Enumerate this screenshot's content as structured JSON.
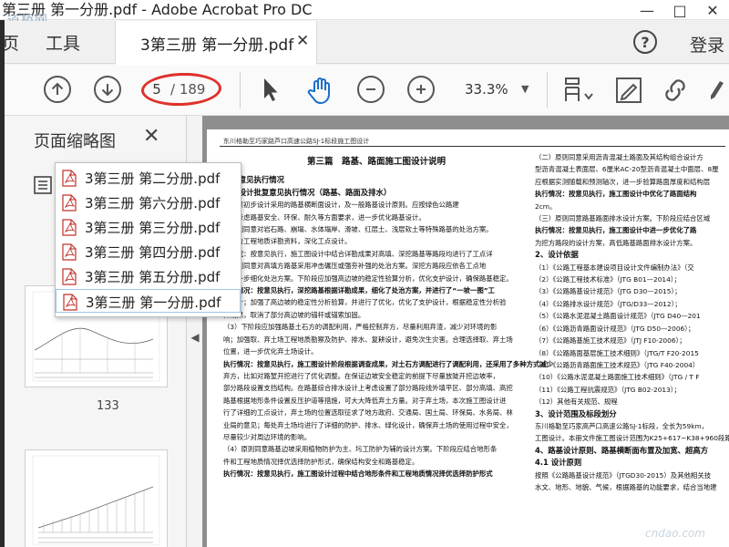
{
  "window": {
    "title": "第三册 第一分册.pdf - Adobe Acrobat Pro DC",
    "watermark": "道桥网",
    "minimize": "—",
    "maximize": "□",
    "close": "✕"
  },
  "menu": {
    "home_partial": "页",
    "tools": "工具",
    "login": "登录",
    "help_glyph": "?"
  },
  "tab": {
    "label": "3第三册 第一分册.pdf",
    "close": "✕"
  },
  "toolbar": {
    "page_current": "5",
    "page_total": "/ 189",
    "zoom": "33.3%",
    "zoom_caret": "▼"
  },
  "sidepane": {
    "title": "页面缩略图",
    "close": "✕",
    "thumb_page_label": "133",
    "collapse_glyph": "◀"
  },
  "dropdown": {
    "items": [
      "3第三册 第二分册.pdf",
      "3第三册 第六分册.pdf",
      "3第三册 第三分册.pdf",
      "3第三册 第四分册.pdf",
      "3第三册 第五分册.pdf",
      "3第三册 第一分册.pdf"
    ],
    "active_index": 5
  },
  "document": {
    "header": "东川格勒至巧家路芦口高速公路SJ-1标段施工图设计",
    "chapter_title": "第三篇　路基、路面施工图设计说明",
    "left_col": [
      "审查意见执行情况",
      "初步设计批复意见执行情况（路基、路面及排水）",
      "）同意初步设计采用的路基横断面设计，及一般路基设计原则。应按绿色公路建",
      "设等考虑路基安全、环保、耐久等方面要求，进一步优化路基设计。",
      "）原则同意对岩石路、崩塌、水体塌岸、滑坡、红层土、浅层软土等特殊路基的处治方案。",
      "应结合工程地质详勘资料，深化工点设计。",
      "行情况：按意见执行，施工图设计中结合详勘成果对高填、深挖路基等路段均进行了工点详",
      "",
      "）原则同意对高填方路基采用冲击碾压或强夯补强的处治方案。深挖方路段应依各工点地",
      "质进一步细化处治方案。下阶段应加强高边坡的稳定性验算分析，优化支护设计，确保路基稳定。",
      "执行情况：按意见执行，深挖路基根据详勘成果，细化了处治方案，并进行了“一坡一图”工",
      "点设计；加强了高边坡的稳定性分析验算，并进行了优化，优化了支护设计，根据稳定性分析验",
      "算成果，取消了部分高边坡的锚杆或锚索加固。",
      "（3）下阶段应加强路基土石方的调配利用，严格控制弃方，尽量利用弃渣，减少对环境的影",
      "响；加强取、弃土场工程地质勘察及防护、排水、复耕设计，避免次生灾害。合理选择取、弃土场",
      "位置，进一步优化弃土场设计。",
      "执行情况：按意见执行，施工图设计阶段根据调查成果，对土石方调配进行了调配利用，还采用了多种方式减少",
      "弃方，比如对路堑开挖进行了优化调整。在保证边坡安全稳定的前提下尽量放陡开挖边坡率，",
      "部分路段设置支挡结构。在路基综合排水设计上考虑设置了部分路段线外填平区、部分高填、高挖",
      "路基根据地形条件设置反压护道等措施，可大大降低弃土方量。对于弃土场，本次施工图设计进",
      "行了详细的工点设计，弃土场的位置选取征求了地方政府、交通局、国土局、环保局、水务局、林",
      "业局的意见；每处弃土场均进行了详细的防护、排水、绿化设计，确保弃土场的使用过程中安全，",
      "尽量较少对周边环境的影响。",
      "（4）原则同意路基边坡采用植物防护为主、圬工防护为辅的设计方案。下阶段应结合地形条",
      "件和工程地质情况择优选择防护形式，确保结构安全和路基稳定。",
      "执行情况：按意见执行，施工图设计过程中结合地形条件和工程地质情况择优选择防护形式"
    ],
    "right_col": [
      "（二）原则同意采用沥青混凝土路面及其结构组合设计方",
      "型沥青混凝土表面层、6厘米AC-20型沥青混凝土中面层、8厘",
      "应根据实测随载和预测轴次，进一步验算路面厚度和结构层",
      "执行情况：按意见执行，施工图设计中优化了路面结构",
      "2cm。",
      "（三）原则同意路基路面排水设计方案。下阶段应结合区域",
      "执行情况：按意见执行，施工图设计中进一步优化了路",
      "为挖方路段的设计方案，高低路基路面排水设计方案。",
      "2、设计依据",
      "（1）《公路工程基本建设项目设计文件编制办法》（交",
      "（2）《公路工程技术标准》（JTG B01—2014）；",
      "（3）《公路路基设计规范》（JTG D30—2015）；",
      "（4）《公路排水设计规范》（JTG/D33—2012）；",
      "（5）《公路水泥混凝土路面设计规范》（JTG D40—201",
      "（6）《公路沥青路面设计规范》（JTG D50—2006）；",
      "（7）《公路路基施工技术规范》（JTJ F10-2006）；",
      "（8）《公路路面基层施工技术细则》（JTG/T F20-2015",
      "（9）《公路沥青路面施工技术规范》（JTG F40-2004）",
      "（10）《公路水泥混凝土路面施工技术细则》（JTG / T F",
      "（11）《公路工程抗震规范》（JTG B02-2013）；",
      "（12）其他有关规范、规程",
      "3、设计范围及标段划分",
      "东川格勒至巧家高芦口高速公路SJ-1标段，全长为59km，",
      "工图设计。本册文件施工图设计范围为K25+617~K38+960段路",
      "4、路基设计原则、路基横断面布置及加宽、超高方",
      "4.1 设计原则",
      "按照《公路路基设计规范》（JTGD30-2015）及其他相关技",
      "水文、地形、地貌、气候，根据路基的功能要求，结合当地建"
    ]
  }
}
